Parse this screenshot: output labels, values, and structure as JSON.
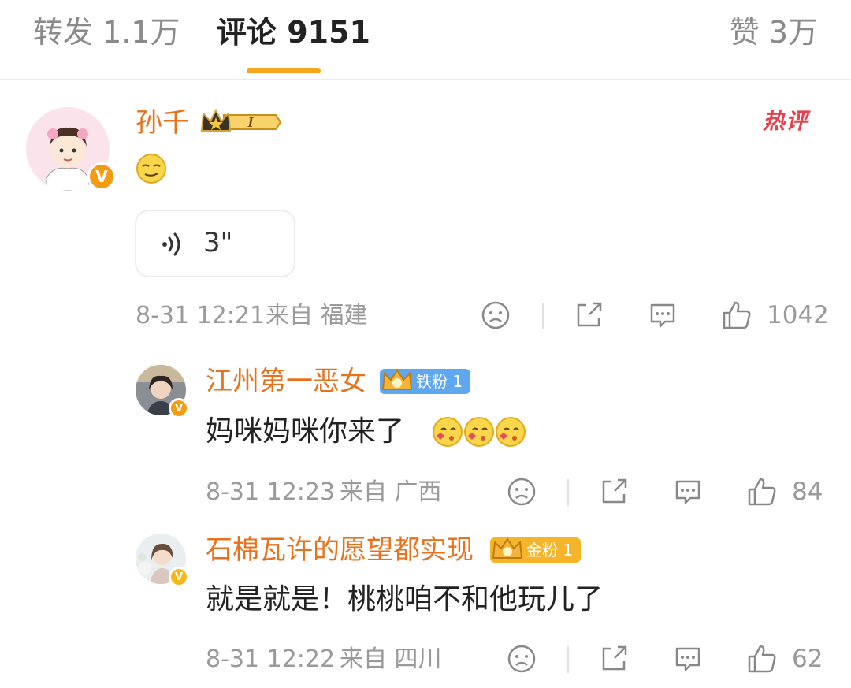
{
  "tabs": {
    "repost": "转发 1.1万",
    "comments": "评论 9151",
    "likes": "赞 3万"
  },
  "colors": {
    "accent": "#f7a51c",
    "username": "#e8721c",
    "hot": "#e8404a",
    "meta": "#9a9a9a"
  },
  "comments": [
    {
      "username": "孙千",
      "level_badge": "I",
      "hot_label": "热评",
      "emoji": "smirk-emoji",
      "voice": {
        "duration": "3\""
      },
      "time": "8-31 12:21",
      "location": "来自 福建",
      "likes": "1042"
    },
    {
      "username": "江州第一恶女",
      "fan_badge": "铁粉 1",
      "text": "妈咪妈咪你来了",
      "emoji": "kiss-emoji",
      "time": "8-31 12:23",
      "location": "来自 广西",
      "likes": "84"
    },
    {
      "username": "石棉瓦许的愿望都实现",
      "fan_badge": "金粉 1",
      "text": "就是就是！桃桃咱不和他玩儿了",
      "time": "8-31 12:22",
      "location": "来自 四川",
      "likes": "62"
    }
  ]
}
